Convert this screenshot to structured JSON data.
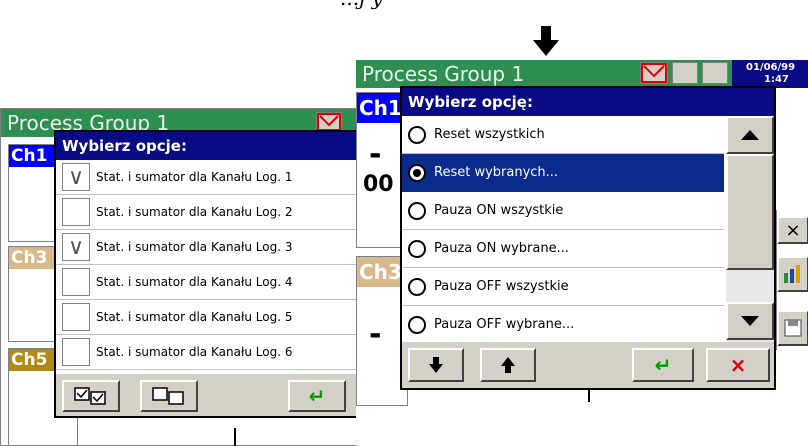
{
  "caption": "...j   y",
  "left_screen": {
    "title": "Process Group 1",
    "ch1": "Ch1",
    "ch3": "Ch3",
    "ch5": "Ch5"
  },
  "left_dialog": {
    "title": "Wybierz opcje:",
    "rows": [
      {
        "label": "Stat. i sumator dla Kanału Log. 1",
        "checked": true,
        "mark": "∨"
      },
      {
        "label": "Stat. i sumator dla Kanału Log. 2",
        "checked": false,
        "mark": ""
      },
      {
        "label": "Stat. i sumator dla Kanału Log. 3",
        "checked": true,
        "mark": "∨"
      },
      {
        "label": "Stat. i sumator dla Kanału Log. 4",
        "checked": false,
        "mark": ""
      },
      {
        "label": "Stat. i sumator dla Kanału Log. 5",
        "checked": false,
        "mark": ""
      },
      {
        "label": "Stat. i sumator dla Kanału Log. 6",
        "checked": false,
        "mark": ""
      }
    ],
    "buttons": {
      "select_all_icon": "select-all-icon",
      "deselect_all_icon": "deselect-all-icon",
      "enter": "↵",
      "cancel": "×"
    }
  },
  "right_screen": {
    "title": "Process Group 1",
    "date": "01/06/99",
    "time": "1:47",
    "ch1": "Ch1",
    "ch3": "Ch3",
    "value_text": "00",
    "dash": "-",
    "close": "×"
  },
  "right_dialog": {
    "title": "Wybierz opcję:",
    "options": [
      {
        "label": "Reset wszystkich",
        "selected": false
      },
      {
        "label": "Reset wybranych...",
        "selected": true
      },
      {
        "label": "Pauza ON wszystkie",
        "selected": false
      },
      {
        "label": "Pauza ON wybrane...",
        "selected": false
      },
      {
        "label": "Pauza OFF wszystkie",
        "selected": false
      },
      {
        "label": "Pauza OFF wybrane...",
        "selected": false
      }
    ],
    "buttons": {
      "down_icon": "arrow-down-icon",
      "up_icon": "arrow-up-icon",
      "enter": "↵",
      "cancel": "×"
    }
  },
  "colors": {
    "title_bar": "#0a0a84",
    "screen_header": "#2f8f52",
    "selection": "#0a2a8c",
    "enter_green": "#00a000",
    "cancel_red": "#e00000"
  }
}
